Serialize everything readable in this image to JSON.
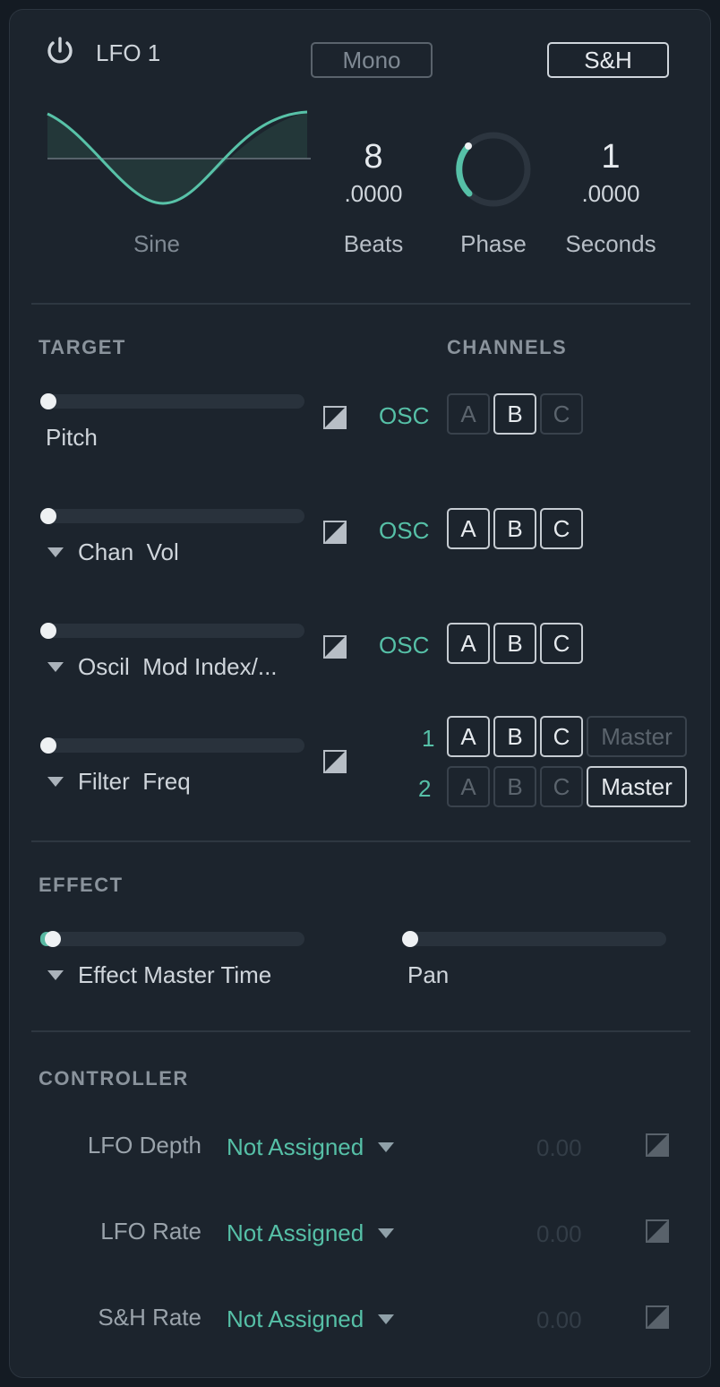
{
  "header": {
    "title": "LFO 1",
    "mono_label": "Mono",
    "sh_label": "S&H"
  },
  "waveform": {
    "label": "Sine",
    "shape": "sine"
  },
  "beats": {
    "whole": "8",
    "fraction": ".0000",
    "label": "Beats"
  },
  "phase": {
    "label": "Phase",
    "value_fraction": 0.15
  },
  "seconds": {
    "whole": "1",
    "fraction": ".0000",
    "label": "Seconds"
  },
  "target": {
    "title": "TARGET",
    "channels_title": "CHANNELS",
    "rows": [
      {
        "label": "Pitch",
        "slider": 0.0,
        "channel_label": "OSC",
        "channels": [
          "A",
          "B",
          "C"
        ]
      },
      {
        "label": "Chan  Vol",
        "slider": 0.0,
        "channel_label": "OSC",
        "channels": [
          "A",
          "B",
          "C"
        ]
      },
      {
        "label": "Oscil  Mod Index/...",
        "slider": 0.0,
        "channel_label": "OSC",
        "channels": [
          "A",
          "B",
          "C"
        ]
      },
      {
        "label": "Filter  Freq",
        "slider": 0.0,
        "filter_rows": [
          {
            "label": "1",
            "channels": [
              "A",
              "B",
              "C",
              "Master"
            ]
          },
          {
            "label": "2",
            "channels": [
              "A",
              "B",
              "C",
              "Master"
            ]
          }
        ]
      }
    ]
  },
  "effect": {
    "title": "EFFECT",
    "left": {
      "label": "Effect Master Time",
      "slider": 0.03
    },
    "right": {
      "label": "Pan",
      "slider": 0.0
    }
  },
  "controller": {
    "title": "CONTROLLER",
    "rows": [
      {
        "label": "LFO Depth",
        "value": "Not Assigned",
        "number": "0.00"
      },
      {
        "label": "LFO Rate",
        "value": "Not Assigned",
        "number": "0.00"
      },
      {
        "label": "S&H Rate",
        "value": "Not Assigned",
        "number": "0.00"
      }
    ]
  },
  "colors": {
    "accent": "#56c0a7",
    "panel": "#1c242d",
    "background": "#141b23"
  }
}
